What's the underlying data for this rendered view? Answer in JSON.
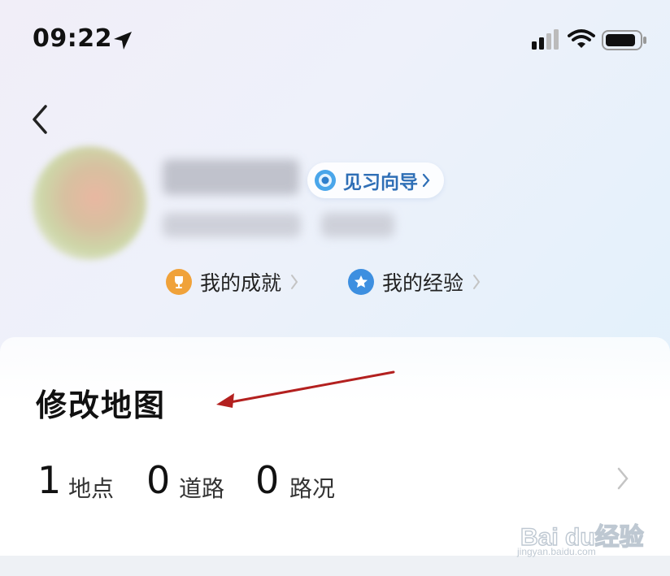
{
  "status_bar": {
    "time": "09:22"
  },
  "profile": {
    "guide_label": "见习向导",
    "achievements_label": "我的成就",
    "experience_label": "我的经验"
  },
  "card": {
    "title": "修改地图",
    "stats": [
      {
        "value": "1",
        "label": "地点"
      },
      {
        "value": "0",
        "label": "道路"
      },
      {
        "value": "0",
        "label": "路况"
      }
    ]
  },
  "watermark": {
    "text": "Bai du经验",
    "sub": "jingyan.baidu.com"
  },
  "colors": {
    "accent": "#2f6fb6",
    "annotation_arrow": "#b3201f",
    "trophy": "#f0a23a",
    "star": "#3d8fe0"
  },
  "icons": [
    "location-arrow-icon",
    "signal-icon",
    "wifi-icon",
    "battery-icon",
    "back-chevron-icon",
    "eye-icon",
    "trophy-icon",
    "star-icon",
    "chevron-right-icon"
  ]
}
